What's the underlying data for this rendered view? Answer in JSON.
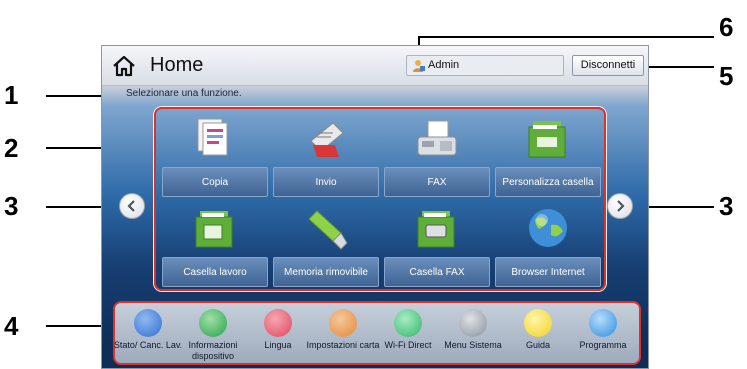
{
  "header": {
    "title": "Home",
    "user": "Admin",
    "logout_label": "Disconnetti"
  },
  "status_message": "Selezionare una funzione.",
  "functions": [
    {
      "label": "Copia",
      "icon": "copy-icon"
    },
    {
      "label": "Invio",
      "icon": "send-icon"
    },
    {
      "label": "FAX",
      "icon": "fax-icon"
    },
    {
      "label": "Personalizza casella",
      "icon": "custom-box-icon"
    },
    {
      "label": "Casella lavoro",
      "icon": "job-box-icon"
    },
    {
      "label": "Memoria rimovibile",
      "icon": "usb-drive-icon"
    },
    {
      "label": "Casella FAX",
      "icon": "fax-box-icon"
    },
    {
      "label": "Browser Internet",
      "icon": "globe-icon"
    }
  ],
  "dock": [
    {
      "label": "Stato/ Canc. Lav.",
      "icon": "status-icon",
      "color": "#2f6fd0"
    },
    {
      "label": "Informazioni dispositivo",
      "icon": "device-info-icon",
      "color": "#26a24a"
    },
    {
      "label": "Lingua",
      "icon": "language-icon",
      "color": "#e0455c"
    },
    {
      "label": "Impostazioni carta",
      "icon": "paper-settings-icon",
      "color": "#e08a3a"
    },
    {
      "label": "Wi-Fi Direct",
      "icon": "wifi-direct-icon",
      "color": "#2fb56a"
    },
    {
      "label": "Menu Sistema",
      "icon": "system-menu-icon",
      "color": "#8a8f99"
    },
    {
      "label": "Guida",
      "icon": "help-icon",
      "color": "#f0d020"
    },
    {
      "label": "Programma",
      "icon": "program-icon",
      "color": "#2f8be0"
    }
  ],
  "callouts": {
    "c1": "1",
    "c2": "2",
    "c3_left": "3",
    "c3_right": "3",
    "c4": "4",
    "c5": "5",
    "c6": "6"
  }
}
